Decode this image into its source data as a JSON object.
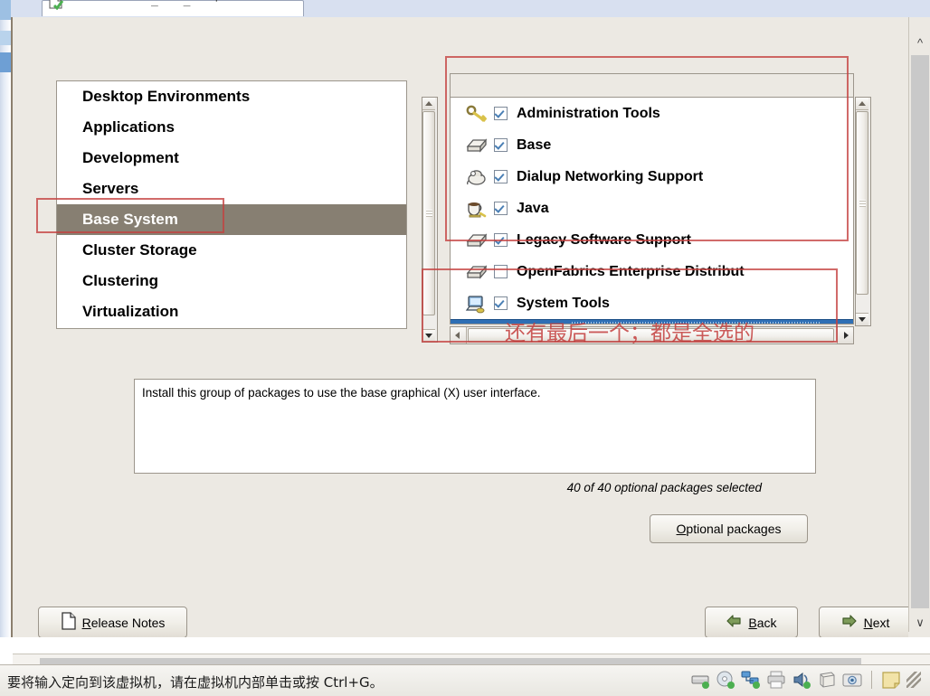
{
  "window": {
    "tab_glyphs": "_  _  ⌐"
  },
  "categories": {
    "items": [
      {
        "label": "Desktop Environments",
        "selected": false
      },
      {
        "label": "Applications",
        "selected": false
      },
      {
        "label": "Development",
        "selected": false
      },
      {
        "label": "Servers",
        "selected": false
      },
      {
        "label": "Base System",
        "selected": true
      },
      {
        "label": "Cluster Storage",
        "selected": false
      },
      {
        "label": "Clustering",
        "selected": false
      },
      {
        "label": "Virtualization",
        "selected": false
      }
    ]
  },
  "packages": {
    "items": [
      {
        "label": "Administration Tools",
        "checked": true,
        "icon": "key-icon"
      },
      {
        "label": "Base",
        "checked": true,
        "icon": "package-icon"
      },
      {
        "label": "Dialup Networking Support",
        "checked": true,
        "icon": "modem-icon"
      },
      {
        "label": "Java",
        "checked": true,
        "icon": "coffee-cup-icon"
      },
      {
        "label": "Legacy Software Support",
        "checked": true,
        "icon": "package-icon"
      },
      {
        "label": "OpenFabrics Enterprise Distribut",
        "checked": false,
        "icon": "package-icon"
      },
      {
        "label": "System Tools",
        "checked": true,
        "icon": "computer-icon"
      }
    ]
  },
  "description": {
    "text": "Install this group of packages to use the base graphical (X) user interface."
  },
  "optional": {
    "count_text": "40 of 40 optional packages selected",
    "button_underline": "O",
    "button_rest": "ptional packages"
  },
  "buttons": {
    "release_underline": "R",
    "release_rest": "elease Notes",
    "back_underline": "B",
    "back_rest": "ack",
    "next_underline": "N",
    "next_rest": "ext"
  },
  "annotations": {
    "note_text": "还有最后一个；都是全选的"
  },
  "statusbar": {
    "message": "要将输入定向到该虚拟机，请在虚拟机内部单击或按 Ctrl+G。",
    "icons": [
      "hard-disk-icon",
      "cd-dvd-icon",
      "network-icon",
      "printer-icon",
      "sound-icon",
      "usb-icon",
      "camera-icon",
      "notes-icon"
    ]
  },
  "colors": {
    "selection": "#877f72",
    "annotation_red": "#c4403f",
    "highlight_blue": "#2f6fb5",
    "window_bg": "#ece9e3"
  }
}
